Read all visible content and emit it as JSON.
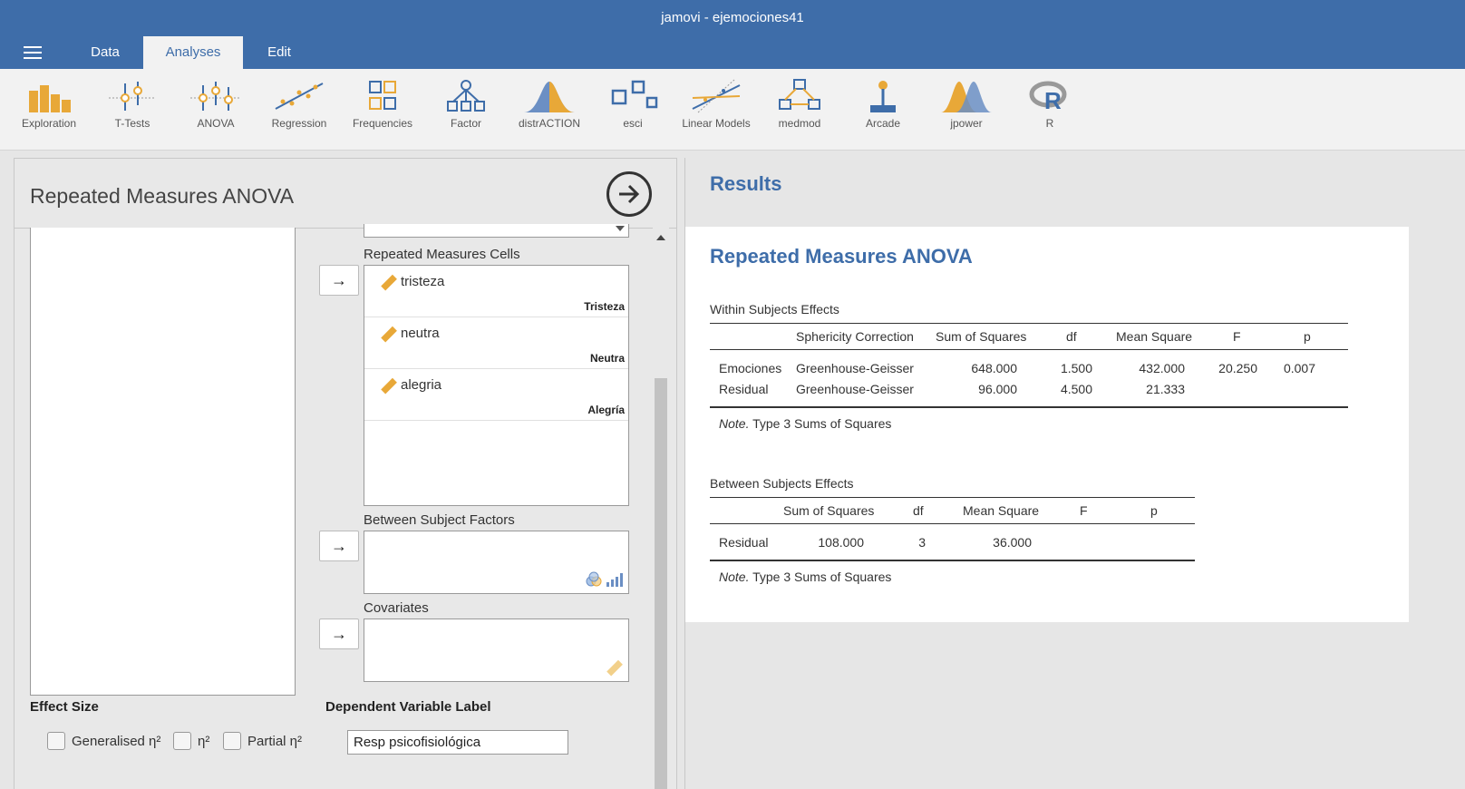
{
  "app": {
    "title": "jamovi - ejemociones41"
  },
  "tabs": [
    {
      "label": "Data"
    },
    {
      "label": "Analyses"
    },
    {
      "label": "Edit"
    }
  ],
  "ribbon": [
    {
      "label": "Exploration",
      "icon": "bar-chart-icon"
    },
    {
      "label": "T-Tests",
      "icon": "t-tests-icon"
    },
    {
      "label": "ANOVA",
      "icon": "anova-icon"
    },
    {
      "label": "Regression",
      "icon": "regression-icon"
    },
    {
      "label": "Frequencies",
      "icon": "frequencies-icon"
    },
    {
      "label": "Factor",
      "icon": "factor-icon"
    },
    {
      "label": "distrACTION",
      "icon": "distribution-icon"
    },
    {
      "label": "esci",
      "icon": "esci-icon"
    },
    {
      "label": "Linear Models",
      "icon": "linear-models-icon"
    },
    {
      "label": "medmod",
      "icon": "medmod-icon"
    },
    {
      "label": "Arcade",
      "icon": "joystick-icon"
    },
    {
      "label": "jpower",
      "icon": "jpower-icon"
    },
    {
      "label": "R",
      "icon": "r-icon"
    }
  ],
  "options": {
    "title": "Repeated Measures ANOVA",
    "rm_cells_label": "Repeated Measures Cells",
    "rm_cells": [
      {
        "var": "tristeza",
        "level": "Tristeza"
      },
      {
        "var": "neutra",
        "level": "Neutra"
      },
      {
        "var": "alegria",
        "level": "Alegría"
      }
    ],
    "between_label": "Between Subject Factors",
    "covariates_label": "Covariates",
    "effect_size_label": "Effect Size",
    "checkboxes": [
      {
        "label": "Generalised η²",
        "checked": false
      },
      {
        "label": "η²",
        "checked": false
      },
      {
        "label": "Partial η²",
        "checked": false
      }
    ],
    "dv_label": "Dependent Variable Label",
    "dv_value": "Resp psicofisiológica"
  },
  "results": {
    "heading": "Results",
    "title": "Repeated Measures ANOVA",
    "within": {
      "caption": "Within Subjects Effects",
      "headers": [
        "",
        "Sphericity Correction",
        "Sum of Squares",
        "df",
        "Mean Square",
        "F",
        "p"
      ],
      "rows": [
        [
          "Emociones",
          "Greenhouse-Geisser",
          "648.000",
          "1.500",
          "432.000",
          "20.250",
          "0.007"
        ],
        [
          "Residual",
          "Greenhouse-Geisser",
          "96.000",
          "4.500",
          "21.333",
          "",
          ""
        ]
      ],
      "note_label": "Note.",
      "note_text": " Type 3 Sums of Squares"
    },
    "between": {
      "caption": "Between Subjects Effects",
      "headers": [
        "",
        "Sum of Squares",
        "df",
        "Mean Square",
        "F",
        "p"
      ],
      "rows": [
        [
          "Residual",
          "108.000",
          "3",
          "36.000",
          "",
          ""
        ]
      ],
      "note_label": "Note.",
      "note_text": " Type 3 Sums of Squares"
    }
  },
  "colors": {
    "brand": "#3e6da9",
    "ruler": "#e8a838"
  }
}
